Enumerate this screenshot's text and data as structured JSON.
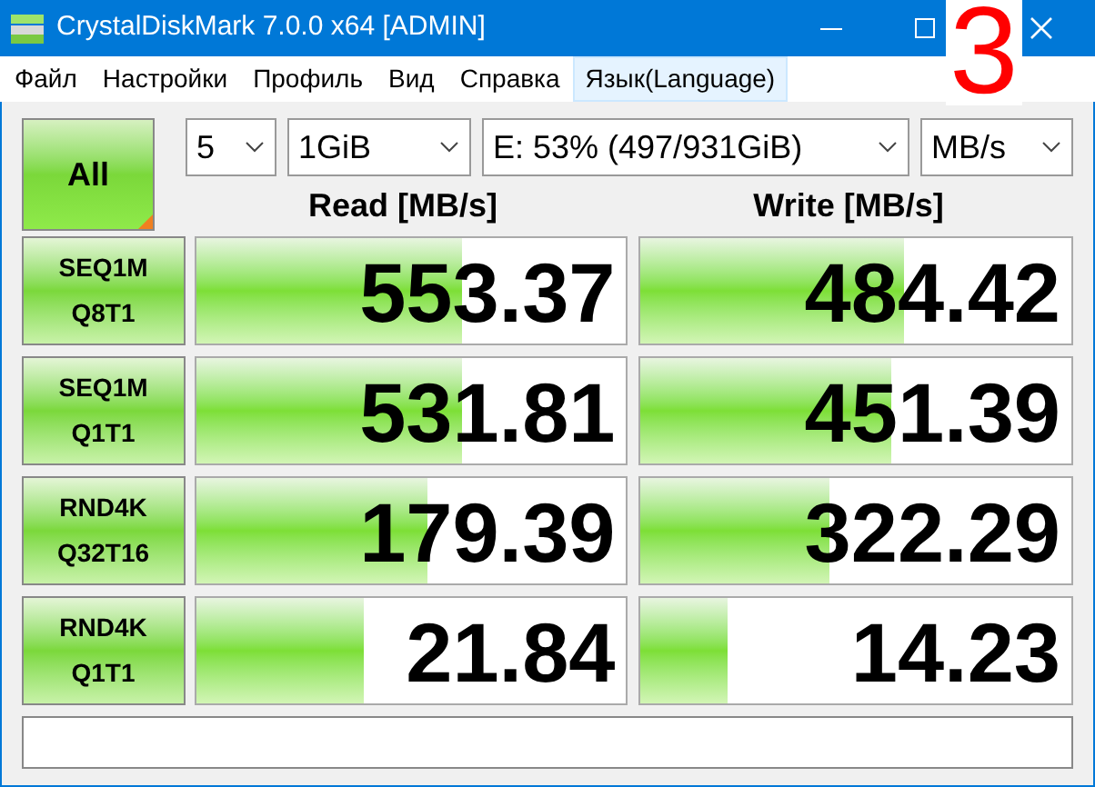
{
  "window": {
    "title": "CrystalDiskMark 7.0.0 x64 [ADMIN]"
  },
  "menu": [
    {
      "label": "Файл",
      "selected": false
    },
    {
      "label": "Настройки",
      "selected": false
    },
    {
      "label": "Профиль",
      "selected": false
    },
    {
      "label": "Вид",
      "selected": false
    },
    {
      "label": "Справка",
      "selected": false
    },
    {
      "label": "Язык(Language)",
      "selected": true
    }
  ],
  "all_button": "All",
  "selectors": [
    {
      "value": "5"
    },
    {
      "value": "1GiB"
    },
    {
      "value": "E: 53% (497/931GiB)"
    },
    {
      "value": "MB/s"
    }
  ],
  "columns": [
    "Read [MB/s]",
    "Write [MB/s]"
  ],
  "rows": [
    {
      "test": "SEQ1M",
      "params": "Q8T1",
      "read": {
        "value": "553.37",
        "level": 0.62
      },
      "write": {
        "value": "484.42",
        "level": 0.61
      }
    },
    {
      "test": "SEQ1M",
      "params": "Q1T1",
      "read": {
        "value": "531.81",
        "level": 0.62
      },
      "write": {
        "value": "451.39",
        "level": 0.58
      }
    },
    {
      "test": "RND4K",
      "params": "Q32T16",
      "read": {
        "value": "179.39",
        "level": 0.54
      },
      "write": {
        "value": "322.29",
        "level": 0.44
      }
    },
    {
      "test": "RND4K",
      "params": "Q1T1",
      "read": {
        "value": "21.84",
        "level": 0.39
      },
      "write": {
        "value": "14.23",
        "level": 0.2
      }
    }
  ],
  "annotation": "3"
}
